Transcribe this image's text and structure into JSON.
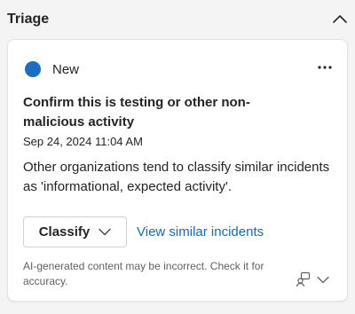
{
  "section": {
    "title": "Triage"
  },
  "card": {
    "status": "New",
    "headline": "Confirm this is testing or other non-malicious activity",
    "timestamp": "Sep 24, 2024 11:04 AM",
    "description": "Other organizations tend to classify similar incidents as 'informational, expected activity'.",
    "classify_label": "Classify",
    "similar_link": "View similar incidents",
    "disclaimer": "AI-generated content may be incorrect. Check it for accuracy."
  },
  "icons": {
    "collapse": "chevron-up-icon",
    "more": "more-horizontal-icon",
    "classify_dropdown": "chevron-down-icon",
    "feedback": "feedback-icon",
    "feedback_dropdown": "chevron-down-icon"
  },
  "colors": {
    "status_dot": "#1a6fc4",
    "link": "#0f6cbd",
    "muted_text": "#616161"
  }
}
